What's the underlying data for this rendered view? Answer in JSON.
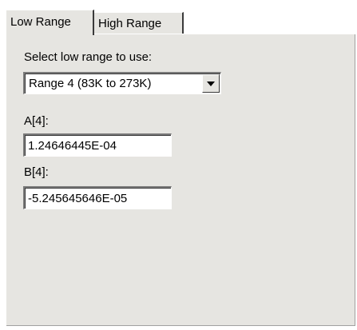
{
  "tabs": {
    "low": {
      "label": "Low Range",
      "active": true
    },
    "high": {
      "label": "High Range",
      "active": false
    }
  },
  "low_range": {
    "select_label": "Select low range to use:",
    "selected_range": "Range 4 (83K to 273K)",
    "a_label": "A[4]:",
    "a_value": "1.24646445E-04",
    "b_label": "B[4]:",
    "b_value": "-5.245645646E-05"
  },
  "colors": {
    "panel_bg": "#e6e5e1",
    "window_bg": "#ffffff"
  },
  "icons": {
    "dropdown": "chevron-down-icon"
  }
}
